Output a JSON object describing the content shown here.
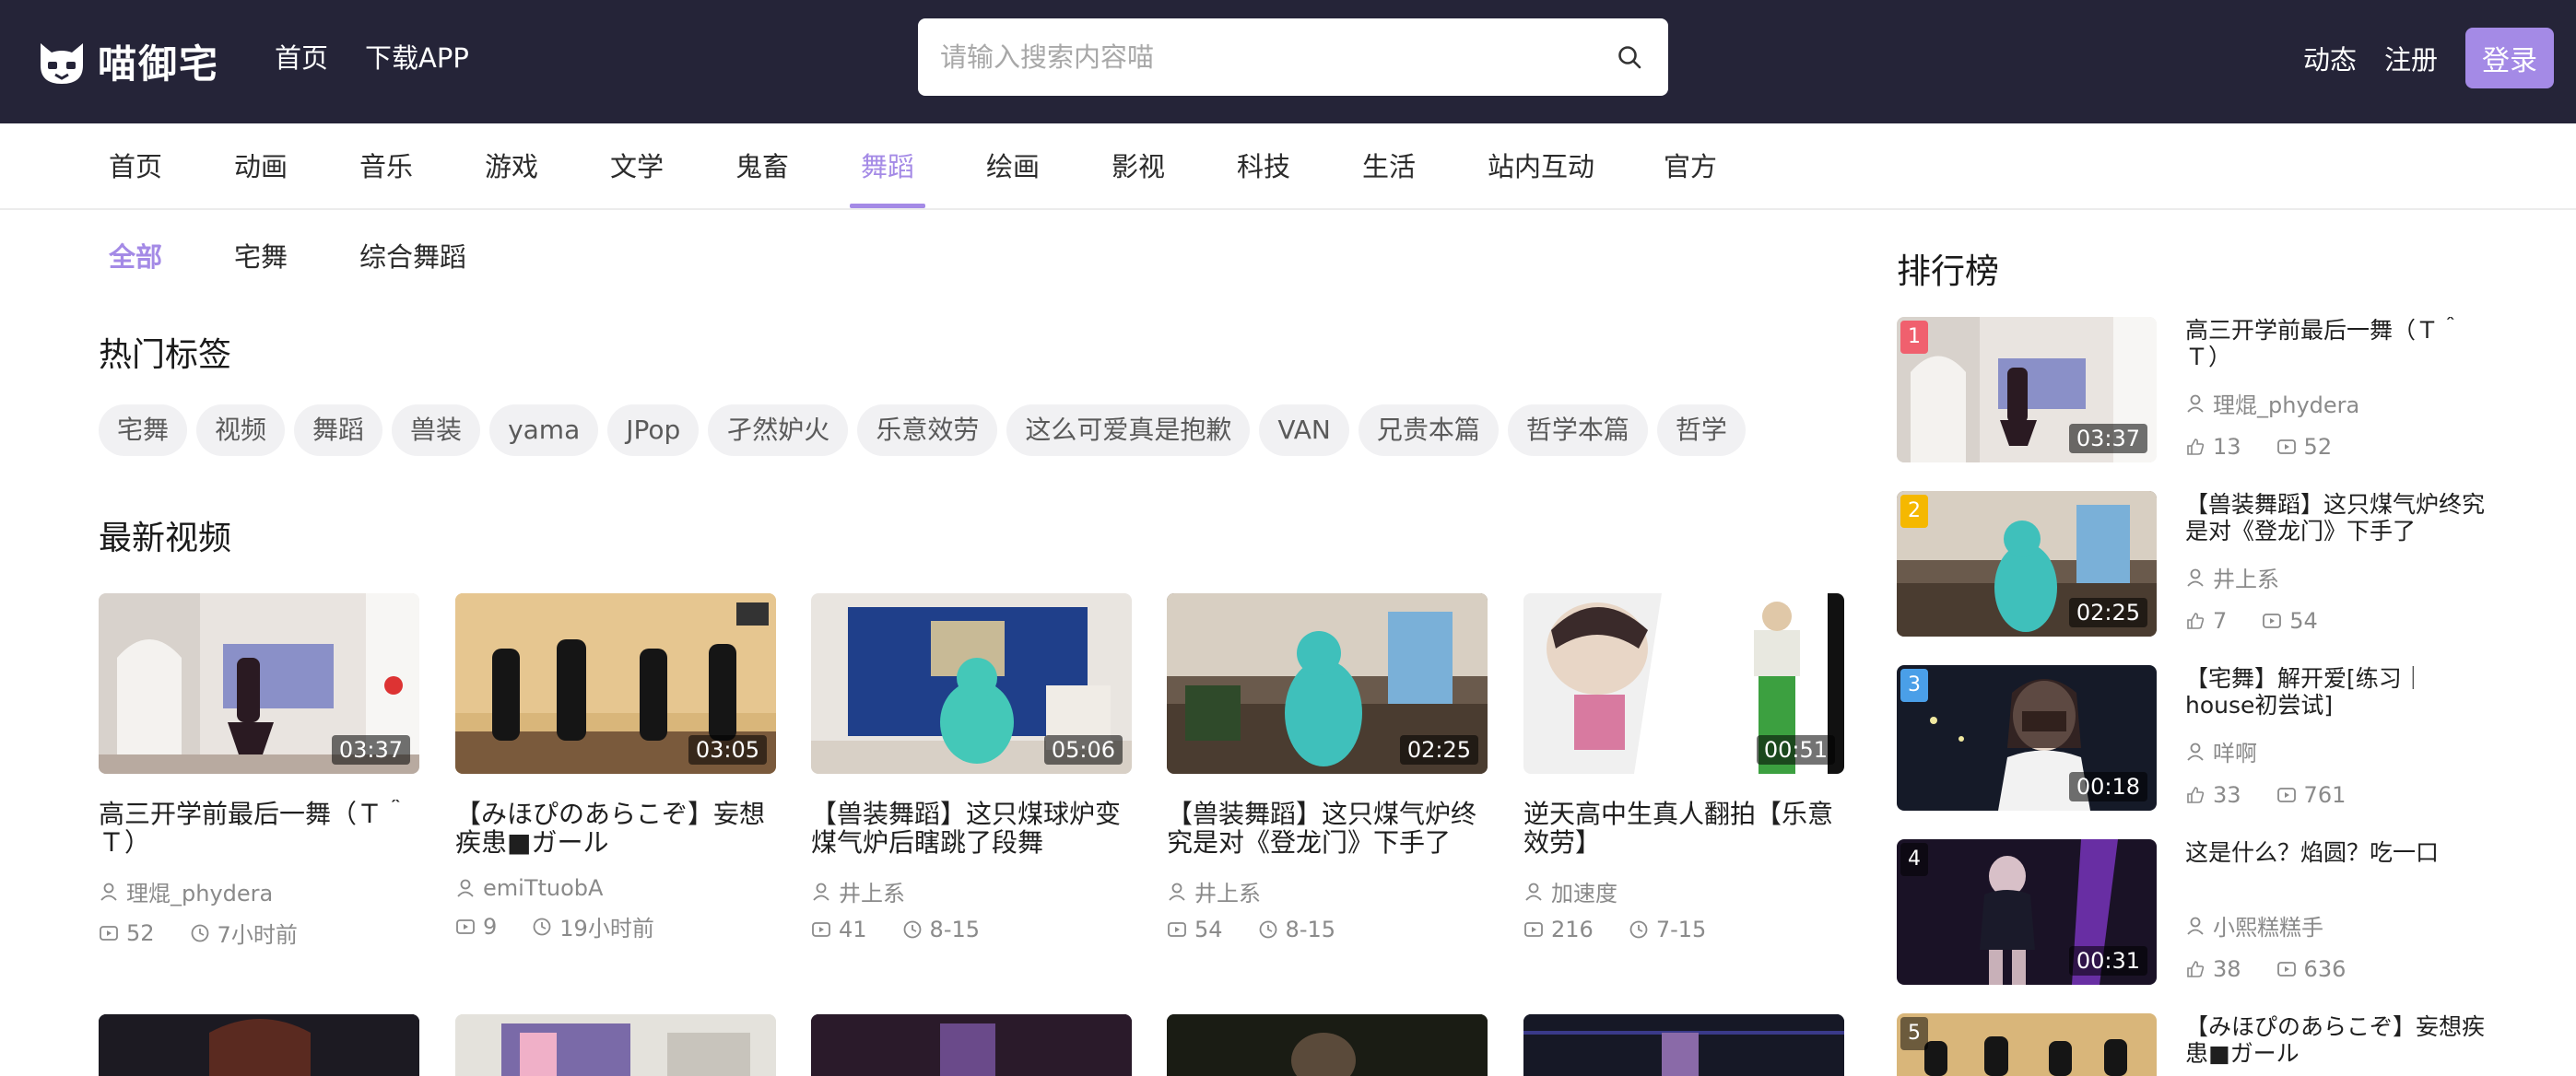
{
  "header": {
    "logo_text": "喵御宅",
    "nav": [
      "首页",
      "下载APP"
    ],
    "search_placeholder": "请输入搜索内容喵",
    "right_links": [
      "动态",
      "注册"
    ],
    "login_label": "登录",
    "accent_color": "#a48ae6",
    "bg_color": "#252438"
  },
  "categories": [
    "首页",
    "动画",
    "音乐",
    "游戏",
    "文学",
    "鬼畜",
    "舞蹈",
    "绘画",
    "影视",
    "科技",
    "生活",
    "站内互动",
    "官方"
  ],
  "active_category": "舞蹈",
  "subtabs": [
    "全部",
    "宅舞",
    "综合舞蹈"
  ],
  "hot_tags_title": "热门标签",
  "hot_tags": [
    "宅舞",
    "视频",
    "舞蹈",
    "兽装",
    "yama",
    "JPop",
    "孑然妒火",
    "乐意效劳",
    "这么可爱真是抱歉",
    "VAN",
    "兄贵本篇",
    "哲学本篇",
    "哲学"
  ],
  "latest_title": "最新视频",
  "videos": [
    {
      "title": "高三开学前最后一舞（Ｔ＾Ｔ）",
      "author": "理焜_phydera",
      "plays": "52",
      "time": "7小时前",
      "duration": "03:37"
    },
    {
      "title": "【みほぴのあらこぞ】妄想疾患■ガール",
      "author": "emiTtuobA",
      "plays": "9",
      "time": "19小时前",
      "duration": "03:05"
    },
    {
      "title": "【兽装舞蹈】这只煤球炉变煤气炉后瞎跳了段舞",
      "author": "井上系",
      "plays": "41",
      "time": "8-15",
      "duration": "05:06"
    },
    {
      "title": "【兽装舞蹈】这只煤气炉终究是对《登龙门》下手了",
      "author": "井上系",
      "plays": "54",
      "time": "8-15",
      "duration": "02:25"
    },
    {
      "title": "逆天高中生真人翻拍【乐意效劳】",
      "author": "加速度",
      "plays": "216",
      "time": "7-15",
      "duration": "00:51"
    }
  ],
  "ranking_title": "排行榜",
  "ranking": [
    {
      "rank": "1",
      "title": "高三开学前最后一舞（Ｔ＾Ｔ）",
      "author": "理焜_phydera",
      "likes": "13",
      "plays": "52",
      "duration": "03:37",
      "badge_color": "#f0606e"
    },
    {
      "rank": "2",
      "title": "【兽装舞蹈】这只煤气炉终究是对《登龙门》下手了",
      "author": "井上系",
      "likes": "7",
      "plays": "54",
      "duration": "02:25",
      "badge_color": "#f5b800"
    },
    {
      "rank": "3",
      "title": "【宅舞】解开爱[练习｜house初尝试]",
      "author": "咩啊",
      "likes": "33",
      "plays": "761",
      "duration": "00:18",
      "badge_color": "#4a9fe8"
    },
    {
      "rank": "4",
      "title": "这是什么？焰圆？吃一口",
      "author": "小熙糕糕手",
      "likes": "38",
      "plays": "636",
      "duration": "00:31",
      "badge_color": "rgba(0,0,0,0.5)"
    },
    {
      "rank": "5",
      "title": "【みほぴのあらこぞ】妄想疾患■ガール",
      "author": "",
      "likes": "",
      "plays": "",
      "duration": "",
      "badge_color": "rgba(0,0,0,0.5)"
    }
  ]
}
